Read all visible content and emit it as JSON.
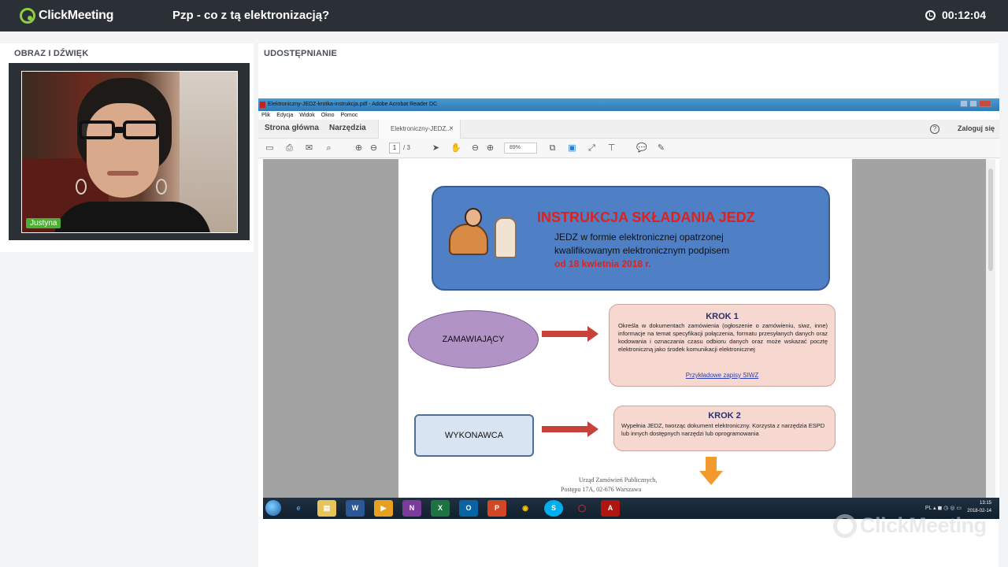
{
  "app": {
    "brand": "ClickMeeting",
    "meeting_title": "Pzp - co z tą elektronizacją?",
    "timer": "00:12:04"
  },
  "left_panel": {
    "heading": "OBRAZ I DŹWIĘK",
    "participant_name": "Justyna"
  },
  "right_panel": {
    "heading": "UDOSTĘPNIANIE"
  },
  "acrobat": {
    "window_title": "Elektroniczny-JEDZ-krotka-instrukcja.pdf - Adobe Acrobat Reader DC",
    "menu": [
      "Plik",
      "Edycja",
      "Widok",
      "Okno",
      "Pomoc"
    ],
    "tabs": {
      "home": "Strona główna",
      "tools": "Narzędzia",
      "document": "Elektroniczny-JEDZ...",
      "close": "×"
    },
    "help": "?",
    "login": "Zaloguj się",
    "page_current": "1",
    "page_total": "/ 3",
    "zoom": "89%"
  },
  "pdf": {
    "banner_title": "INSTRUKCJA SKŁADANIA JEDZ",
    "banner_line1": "JEDZ w formie elektronicznej opatrzonej",
    "banner_line2": "kwalifikowanym elektronicznym podpisem",
    "banner_date": "od 18 kwietnia 2018 r.",
    "ordering_party": "ZAMAWIAJĄCY",
    "contractor": "WYKONAWCA",
    "step1_title": "KROK 1",
    "step1_text": "Określa w dokumentach zamówienia (ogłoszenie o zamówieniu, siwz, inne) informacje na temat specyfikacji połączenia, formatu przesyłanych danych oraz kodowania i oznaczania czasu odbioru danych oraz może wskazać pocztę elektroniczną jako środek komunikacji elektronicznej",
    "step1_link": "Przykładowe zapisy SIWZ",
    "step2_title": "KROK 2",
    "step2_text": "Wypełnia JEDZ, tworząc dokument elektroniczny. Korzysta z narzędzia ESPD lub innych dostępnych narzędzi lub oprogramowania",
    "footer_line1": "Urząd Zamówień Publicznych,",
    "footer_line2": "Postępu 17A, 02-676 Warszawa"
  },
  "taskbar": {
    "apps": [
      "e",
      "▤",
      "W",
      "▶",
      "N",
      "X",
      "O",
      "P",
      "◉",
      "S",
      "◯",
      "A"
    ],
    "tray": "PL ▴ ◼ ◷ ◎ ▭",
    "time": "13:15",
    "date": "2018-02-14"
  },
  "watermark": "ClickMeeting",
  "colors": {
    "accent_green": "#8fcc3f",
    "banner_blue": "#4f80c5",
    "title_red": "#e0201b",
    "step_pink": "#f6d8d0"
  }
}
